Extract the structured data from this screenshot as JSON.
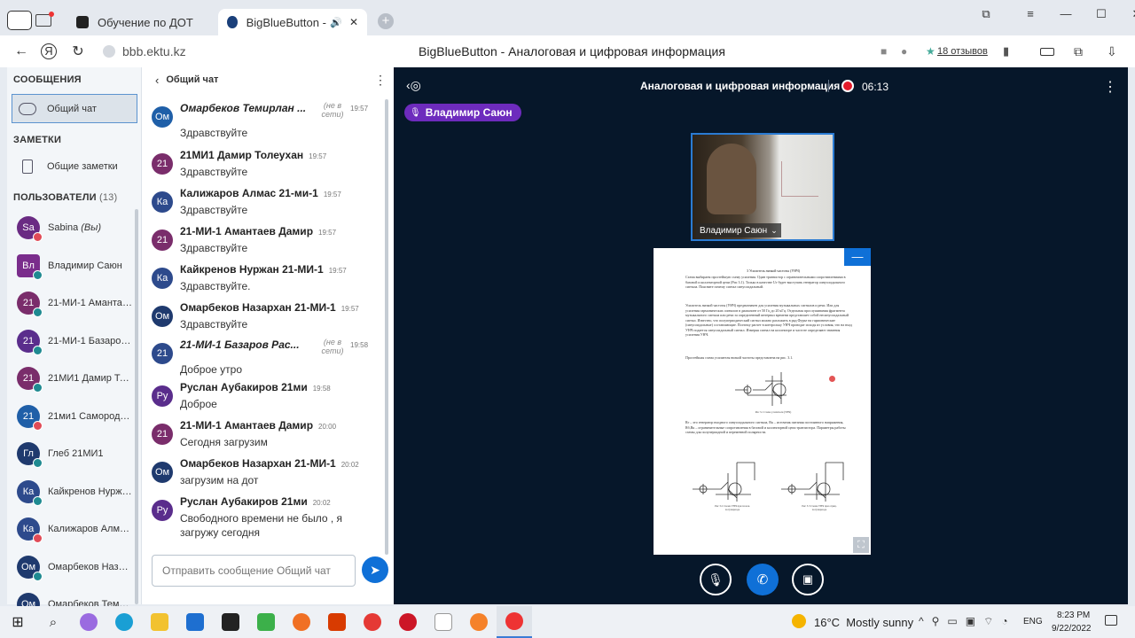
{
  "browser": {
    "tabs": [
      {
        "title": "Обучение по ДОТ",
        "active": false
      },
      {
        "title": "BigBlueButton - Анал",
        "active": true
      }
    ],
    "new_tab": "+",
    "url": "bbb.ektu.kz",
    "page_title": "BigBlueButton - Аналоговая и цифровая информация",
    "reviews": "18 отзывов",
    "window_controls": [
      "⧉",
      "≡",
      "—",
      "☐",
      "✕"
    ]
  },
  "sidebar": {
    "messages_title": "СООБЩЕНИЯ",
    "public_chat": "Общий чат",
    "notes_title": "ЗАМЕТКИ",
    "shared_notes": "Общие заметки",
    "users_title": "ПОЛЬЗОВАТЕЛИ",
    "users_count": "(13)",
    "users": [
      {
        "initials": "Sa",
        "name": "Sabina",
        "you": "(Вы)",
        "color": "#6a2b83",
        "badge": "#e14b57",
        "moderator": false
      },
      {
        "initials": "Вл",
        "name": "Владимир Саюн",
        "color": "#7a2d8c",
        "badge": "#1f8a91",
        "moderator": true
      },
      {
        "initials": "21",
        "name": "21-МИ-1 Амантаев...",
        "color": "#7a2d6b",
        "badge": "#1f8a91",
        "moderator": false
      },
      {
        "initials": "21",
        "name": "21-МИ-1 Базаров ...",
        "color": "#5a2d8c",
        "badge": "#1f8a91",
        "moderator": false
      },
      {
        "initials": "21",
        "name": "21МИ1 Дамир Тол...",
        "color": "#7a2d6b",
        "badge": "#1f8a91",
        "moderator": false
      },
      {
        "initials": "21",
        "name": "21ми1 Самородов...",
        "color": "#1f5fa8",
        "badge": "#e14b57",
        "moderator": false
      },
      {
        "initials": "Гл",
        "name": "Глеб 21МИ1",
        "color": "#1f3a6e",
        "badge": "#1f8a91",
        "moderator": false
      },
      {
        "initials": "Ка",
        "name": "Кайкренов Нуржа...",
        "color": "#2d4a8c",
        "badge": "#1f8a91",
        "moderator": false
      },
      {
        "initials": "Ка",
        "name": "Калижаров Алма...",
        "color": "#2d4a8c",
        "badge": "#e14b57",
        "moderator": false
      },
      {
        "initials": "Ом",
        "name": "Омарбеков Назар...",
        "color": "#1f3a6e",
        "badge": "#1f8a91",
        "moderator": false
      },
      {
        "initials": "Ом",
        "name": "Омарбеков Теми...",
        "color": "#1f3a6e",
        "badge": "#1f8a91",
        "moderator": false
      }
    ]
  },
  "chat": {
    "header": "Общий чат",
    "placeholder": "Отправить сообщение Общий чат",
    "messages": [
      {
        "initials": "Ом",
        "color": "#1f5fa8",
        "name": "Омарбеков Темирлан ...",
        "offline": "(не в сети)",
        "time": "19:57",
        "text": "Здравствуйте",
        "italic": true
      },
      {
        "initials": "21",
        "color": "#7a2d6b",
        "name": "21МИ1 Дамир Толеухан",
        "time": "19:57",
        "text": "Здравствуйте"
      },
      {
        "initials": "Ка",
        "color": "#2d4a8c",
        "name": "Калижаров Алмас 21-ми-1",
        "time": "19:57",
        "text": "Здравствуйте"
      },
      {
        "initials": "21",
        "color": "#7a2d6b",
        "name": "21-МИ-1 Амантаев Дамир",
        "time": "19:57",
        "text": "Здравствуйте"
      },
      {
        "initials": "Ка",
        "color": "#2d4a8c",
        "name": "Кайкренов Нуржан 21-МИ-1",
        "time": "19:57",
        "text": "Здравствуйте."
      },
      {
        "initials": "Ом",
        "color": "#1f3a6e",
        "name": "Омарбеков Назархан 21-МИ-1",
        "time": "19:57",
        "text": "Здравствуйте"
      },
      {
        "initials": "21",
        "color": "#2d4a8c",
        "name": "21-МИ-1 Базаров Рас...",
        "offline": "(не в сети)",
        "time": "19:58",
        "text": "Доброе утро",
        "italic": true
      },
      {
        "initials": "Ру",
        "color": "#5a2d8c",
        "name": "Руслан Аубакиров 21ми",
        "time": "19:58",
        "text": "Доброе"
      },
      {
        "initials": "21",
        "color": "#7a2d6b",
        "name": "21-МИ-1 Амантаев Дамир",
        "time": "20:00",
        "text": "Сегодня загрузим"
      },
      {
        "initials": "Ом",
        "color": "#1f3a6e",
        "name": "Омарбеков Назархан 21-МИ-1",
        "time": "20:02",
        "text": "загрузим на дот"
      },
      {
        "initials": "Ру",
        "color": "#5a2d8c",
        "name": "Руслан Аубакиров 21ми",
        "time": "20:02",
        "text": "Свободного времени не было , я загружу сегодня"
      }
    ]
  },
  "stage": {
    "title": "Аналоговая и цифровая информация",
    "timer": "06:13",
    "talking": "Владимир Саюн",
    "webcam_name": "Владимир Саюн",
    "slide": {
      "heading": "3 Усилитель низкой частоты (УНЧ)",
      "para1": "Схема выбираем простейшую схему усиления. Один транзистор с ограничительными сопротивлениями в базовой и коллекторной цепи (Рис 3.1). Только в качестве Uг будет выступать генератор синусоидального сигнала. Поясните почему сигнал синусоидальный.",
      "para2": "Усилитель низкой частоты (УНЧ) предназначен для усиления музыкальных сигналов и речи. Или для усиления гармонических сигналов в диапазоне от 50 Гц до 20 кГц. Отдельная прослушивания фрагмента музыкального сигнала или речи за определенный интервал времени представляет собой несинусоидальный сигнал. Известно, что полупериодический сигнал можно разложить в ряд Фурье на гармонические (синусоидальные) составляющие. Поэтому расчет в контрольку УНЧ проводят исходя из условия, что на вход УНЧ подается синусоидальный сигнал. Измеряя сигнал на коллекторе и частоте определяют значения усиления УНЧ.",
      "para3": "Простейшая схема усилителя низкой частоты представлена на рис. 3.1.",
      "fig1": "Рис 3.1 Схема усилителя (УНЧ)",
      "para4": "Rг – это генератор входного синусоидального сигнала, Rк – источник питания постоянного напряжения, Rб,Rк – ограничительные сопротивления в базовой и коллекторной цепи транзистора. Параметры работы схемы для полупериодной и переменной полярности.",
      "fig2": "Рис 3.2 Схема УНЧ при полож. полупериоде",
      "fig3": "Рис 3.3 Схема УНЧ при отриц. полупериоде"
    }
  },
  "taskbar": {
    "weather": "16°C  Mostly sunny",
    "lang": "ENG",
    "time": "8:23 PM",
    "date": "9/22/2022"
  },
  "colors": {
    "accent": "#0f70d7",
    "stage_bg": "#06172a",
    "talking_pill": "#6d2bbd",
    "record": "#e31b2a"
  }
}
